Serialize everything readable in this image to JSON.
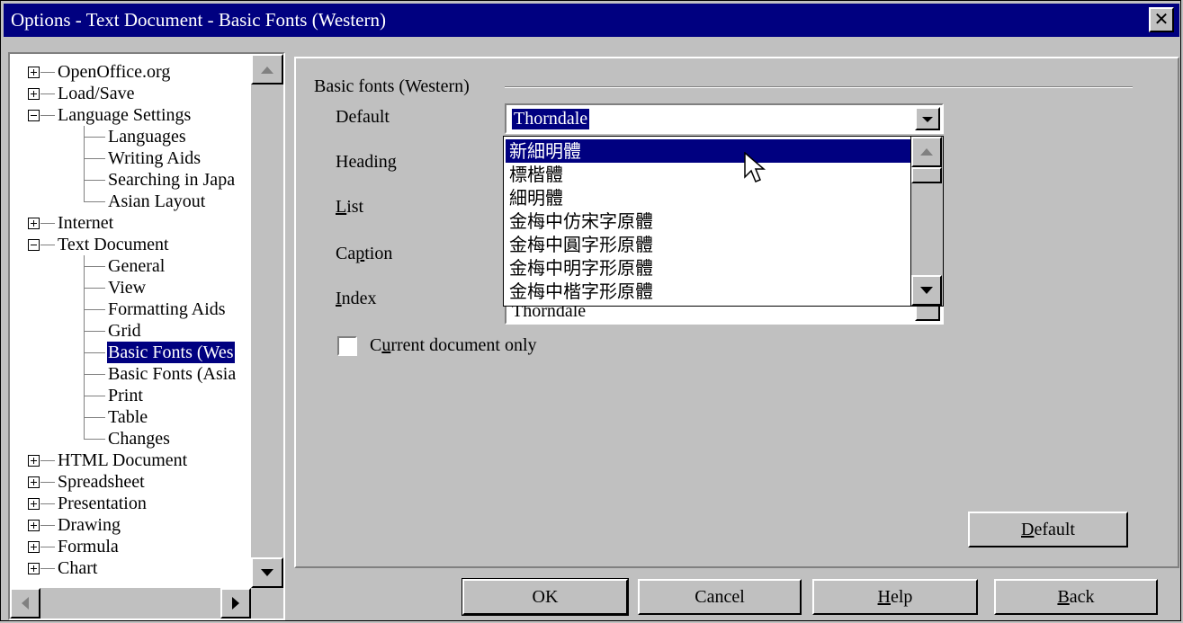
{
  "window": {
    "title": "Options - Text Document - Basic Fonts (Western)",
    "close_glyph": "✕"
  },
  "tree": {
    "items": [
      {
        "label": "OpenOffice.org",
        "level": 0,
        "expander": "plus"
      },
      {
        "label": "Load/Save",
        "level": 0,
        "expander": "plus"
      },
      {
        "label": "Language Settings",
        "level": 0,
        "expander": "minus"
      },
      {
        "label": "Languages",
        "level": 1
      },
      {
        "label": "Writing Aids",
        "level": 1
      },
      {
        "label": "Searching in Japa",
        "level": 1
      },
      {
        "label": "Asian Layout",
        "level": 1
      },
      {
        "label": "Internet",
        "level": 0,
        "expander": "plus"
      },
      {
        "label": "Text Document",
        "level": 0,
        "expander": "minus"
      },
      {
        "label": "General",
        "level": 1
      },
      {
        "label": "View",
        "level": 1
      },
      {
        "label": "Formatting Aids",
        "level": 1
      },
      {
        "label": "Grid",
        "level": 1
      },
      {
        "label": "Basic Fonts (Wes",
        "level": 1,
        "selected": true
      },
      {
        "label": "Basic Fonts (Asia",
        "level": 1
      },
      {
        "label": "Print",
        "level": 1
      },
      {
        "label": "Table",
        "level": 1
      },
      {
        "label": "Changes",
        "level": 1
      },
      {
        "label": "HTML Document",
        "level": 0,
        "expander": "plus"
      },
      {
        "label": "Spreadsheet",
        "level": 0,
        "expander": "plus"
      },
      {
        "label": "Presentation",
        "level": 0,
        "expander": "plus"
      },
      {
        "label": "Drawing",
        "level": 0,
        "expander": "plus"
      },
      {
        "label": "Formula",
        "level": 0,
        "expander": "plus"
      },
      {
        "label": "Chart",
        "level": 0,
        "expander": "plus"
      }
    ]
  },
  "main": {
    "group_title": "Basic fonts (Western)",
    "labels": {
      "default": "Default",
      "heading": "Heading",
      "list_pre": "",
      "list_acc": "L",
      "list_post": "ist",
      "caption_pre": "Ca",
      "caption_acc": "p",
      "caption_post": "tion",
      "index_pre": "",
      "index_acc": "I",
      "index_post": "ndex"
    },
    "default_value": "Thorndale",
    "index_value": "Thorndale",
    "dropdown_items": [
      "新細明體",
      "標楷體",
      "細明體",
      "金梅中仿宋字原體",
      "金梅中圓字形原體",
      "金梅中明字形原體",
      "金梅中楷字形原體"
    ],
    "dropdown_selected_index": 0,
    "checkbox": {
      "pre": "C",
      "acc": "u",
      "post": "rrent document only",
      "checked": false
    },
    "default_button": {
      "acc": "D",
      "post": "efault"
    }
  },
  "buttons": {
    "ok": "OK",
    "cancel": "Cancel",
    "help_acc": "H",
    "help_post": "elp",
    "back_acc": "B",
    "back_post": "ack"
  },
  "colors": {
    "face": "#c0c0c0",
    "title_bg": "#000080",
    "selection": "#000080"
  }
}
